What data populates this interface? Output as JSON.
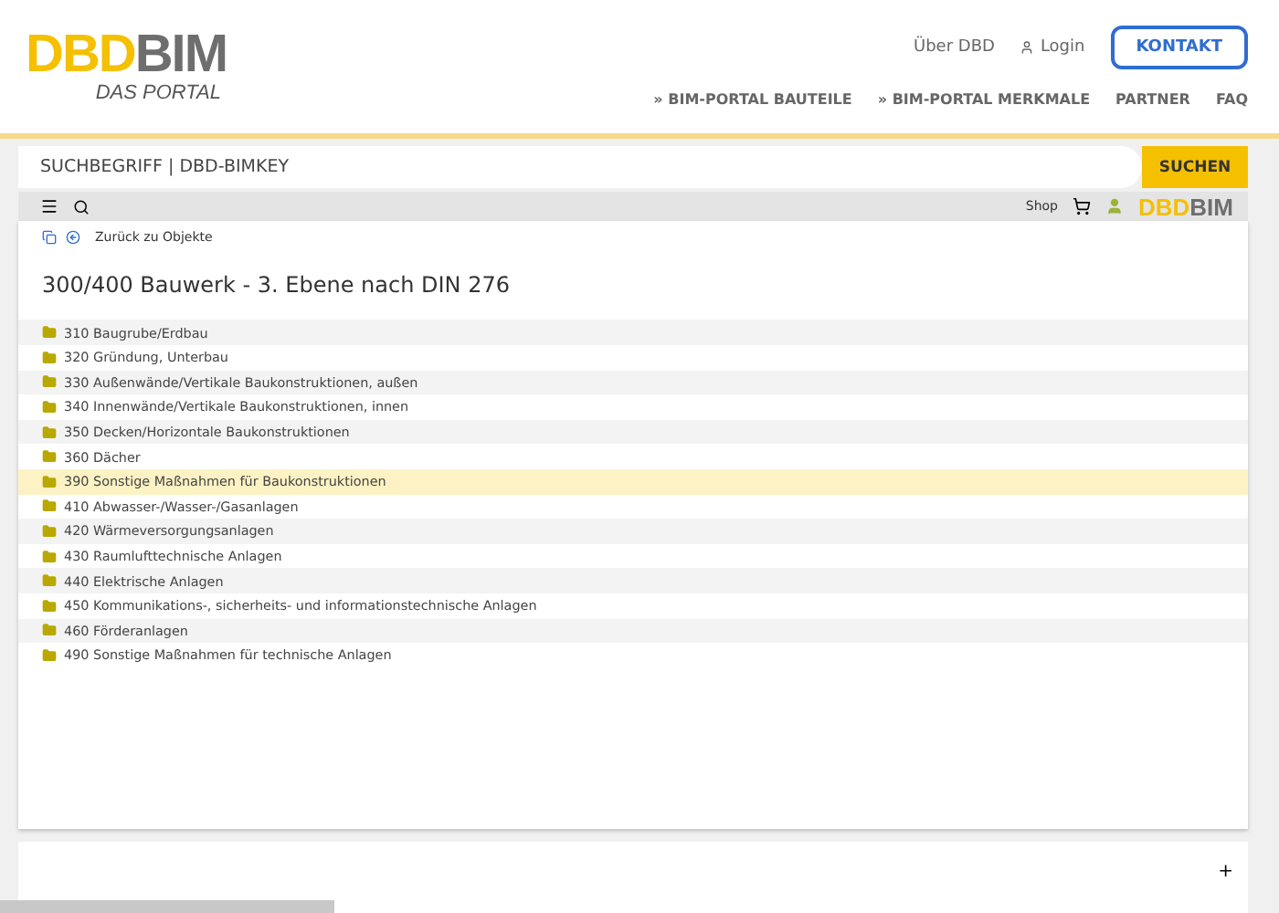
{
  "header": {
    "logo": {
      "left": "DBD",
      "right": "BIM",
      "subtitle": "DAS PORTAL"
    },
    "top_links": [
      "Über DBD",
      "Login"
    ],
    "contact_button": "KONTAKT",
    "nav": [
      "» BIM-PORTAL BAUTEILE",
      "» BIM-PORTAL MERKMALE",
      "PARTNER",
      "FAQ"
    ]
  },
  "search": {
    "placeholder": "SUCHBEGRIFF | DBD-BIMKEY",
    "button": "SUCHEN"
  },
  "toolbar": {
    "shop": "Shop",
    "brand_left": "DBD",
    "brand_right": "BIM"
  },
  "back_link": "Zurück zu Objekte",
  "title": "300/400 Bauwerk - 3. Ebene nach DIN 276",
  "items": [
    {
      "label": "310 Baugrube/Erdbau",
      "selected": false
    },
    {
      "label": "320 Gründung, Unterbau",
      "selected": false
    },
    {
      "label": "330 Außenwände/Vertikale Baukonstruktionen, außen",
      "selected": false
    },
    {
      "label": "340 Innenwände/Vertikale Baukonstruktionen, innen",
      "selected": false
    },
    {
      "label": "350 Decken/Horizontale Baukonstruktionen",
      "selected": false
    },
    {
      "label": "360 Dächer",
      "selected": false
    },
    {
      "label": "390 Sonstige Maßnahmen für Baukonstruktionen",
      "selected": true
    },
    {
      "label": "410 Abwasser-/Wasser-/Gasanlagen",
      "selected": false
    },
    {
      "label": "420 Wärmeversorgungsanlagen",
      "selected": false
    },
    {
      "label": "430 Raumlufttechnische Anlagen",
      "selected": false
    },
    {
      "label": "440 Elektrische Anlagen",
      "selected": false
    },
    {
      "label": "450 Kommunikations-, sicherheits- und informationstechnische Anlagen",
      "selected": false
    },
    {
      "label": "460 Förderanlagen",
      "selected": false
    },
    {
      "label": "490 Sonstige Maßnahmen für technische Anlagen",
      "selected": false
    }
  ],
  "bottom_panel": {
    "expand": "+"
  }
}
